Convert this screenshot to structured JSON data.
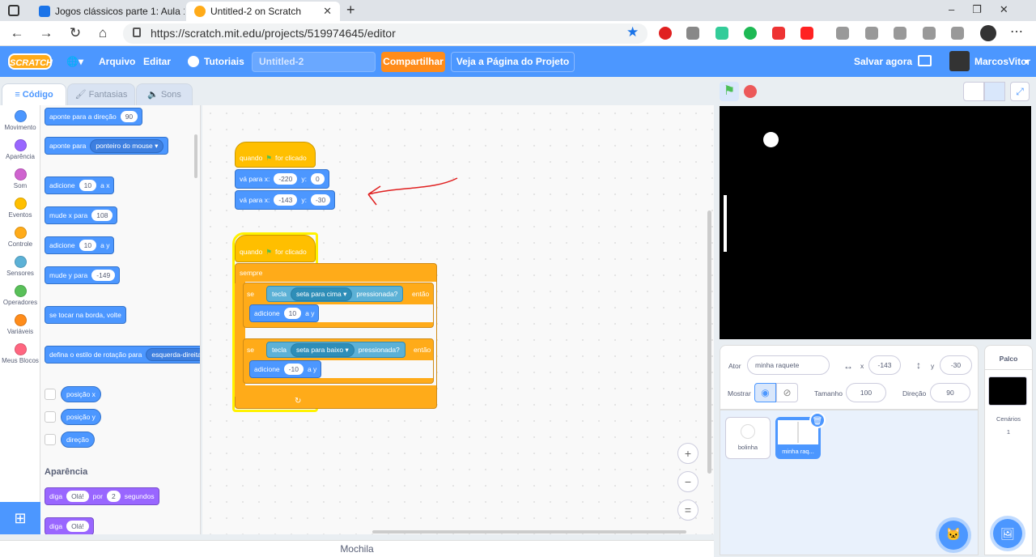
{
  "browser": {
    "tab1": "Jogos clássicos parte 1: Aula 1 - ",
    "tab2": "Untitled-2 on Scratch",
    "url": "https://scratch.mit.edu/projects/519974645/editor"
  },
  "menu": {
    "logo": "SCRATCH",
    "globe": "🌐▾",
    "file": "Arquivo",
    "edit": "Editar",
    "tutorials": "Tutoriais",
    "title": "Untitled-2",
    "share": "Compartilhar",
    "see": "Veja a Página do Projeto",
    "save": "Salvar agora",
    "user": "MarcosVitor"
  },
  "tabs": {
    "code": "Código",
    "costumes": "Fantasias",
    "sounds": "Sons"
  },
  "categories": [
    {
      "label": "Movimento",
      "color": "#4c97ff"
    },
    {
      "label": "Aparência",
      "color": "#9966ff"
    },
    {
      "label": "Som",
      "color": "#cf63cf"
    },
    {
      "label": "Eventos",
      "color": "#ffbf00"
    },
    {
      "label": "Controle",
      "color": "#ffab19"
    },
    {
      "label": "Sensores",
      "color": "#5cb1d6"
    },
    {
      "label": "Operadores",
      "color": "#59c059"
    },
    {
      "label": "Variáveis",
      "color": "#ff8c1a"
    },
    {
      "label": "Meus Blocos",
      "color": "#ff6680"
    }
  ],
  "palette": {
    "point_dir": "aponte  para a direção",
    "point_dir_v": "90",
    "point_to": "aponte para",
    "point_to_v": "ponteiro do mouse",
    "change_x": "adicione",
    "change_x_v": "10",
    "change_x_s": "a x",
    "set_x": "mude x para",
    "set_x_v": "108",
    "change_y": "adicione",
    "change_y_v": "10",
    "change_y_s": "a y",
    "set_y": "mude y para",
    "set_y_v": "-149",
    "bounce": "se tocar na borda, volte",
    "rot": "defina o estilo de rotação para",
    "rot_v": "esquerda-direita",
    "xpos": "posição x",
    "ypos": "posição y",
    "dir": "direção",
    "looks_head": "Aparência",
    "say_for": "diga",
    "say_for_v": "Olá!",
    "say_for_m": "por",
    "say_for_n": "2",
    "say_for_s": "segundos",
    "say": "diga",
    "say_v": "Olá!"
  },
  "script1": {
    "hat": "quando",
    "hat2": "for clicado",
    "goto1": "vá para x:",
    "x1": "-220",
    "ylab": "y:",
    "y1": "0",
    "goto2": "vá para x:",
    "x2": "-143",
    "y2": "-30"
  },
  "script2": {
    "hat": "quando",
    "hat2": "for clicado",
    "forever": "sempre",
    "if1": "se",
    "key": "tecla",
    "key1": "seta para cima",
    "pressed": "pressionada?",
    "then": "então",
    "add1": "adicione",
    "add1v": "10",
    "ay": "a y",
    "key2": "seta para baixo",
    "add2v": "-10"
  },
  "sprite": {
    "label": "Ator",
    "name": "minha raquete",
    "x": "-143",
    "y": "-30",
    "show": "Mostrar",
    "size_l": "Tamanho",
    "size": "100",
    "dir_l": "Direção",
    "dir": "90"
  },
  "sprites": [
    "bolinha",
    "minha raq..."
  ],
  "stagepanel": {
    "title": "Palco",
    "sceneries": "Cenários",
    "count": "1"
  },
  "backpack": "Mochila"
}
